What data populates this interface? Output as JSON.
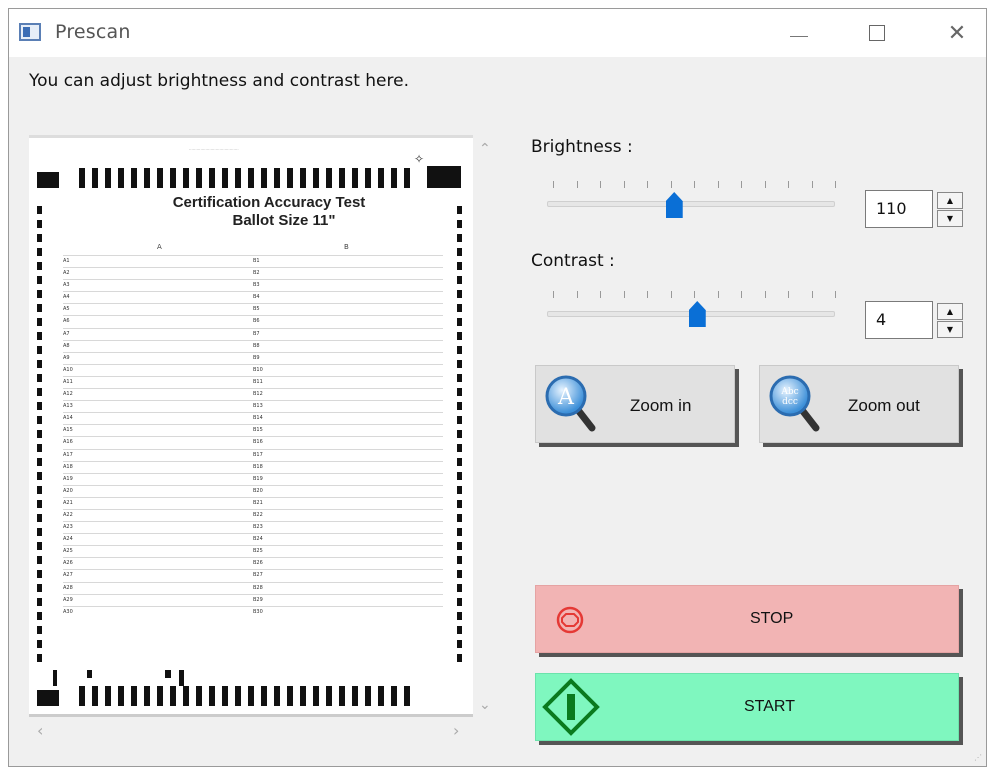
{
  "window": {
    "title": "Prescan"
  },
  "instruction": "You can adjust brightness and contrast here.",
  "preview": {
    "ballot_title": "Certification Accuracy Test",
    "ballot_subtitle": "Ballot  Size 11\"",
    "column_a": "A",
    "column_b": "B",
    "rows_a": [
      "A1",
      "A2",
      "A3",
      "A4",
      "A5",
      "A6",
      "A7",
      "A8",
      "A9",
      "A10",
      "A11",
      "A12",
      "A13",
      "A14",
      "A15",
      "A16",
      "A17",
      "A18",
      "A19",
      "A20",
      "A21",
      "A22",
      "A23",
      "A24",
      "A25",
      "A26",
      "A27",
      "A28",
      "A29",
      "A30"
    ],
    "rows_b": [
      "B1",
      "B2",
      "B3",
      "B4",
      "B5",
      "B6",
      "B7",
      "B8",
      "B9",
      "B10",
      "B11",
      "B12",
      "B13",
      "B14",
      "B15",
      "B16",
      "B17",
      "B18",
      "B19",
      "B20",
      "B21",
      "B22",
      "B23",
      "B24",
      "B25",
      "B26",
      "B27",
      "B28",
      "B29",
      "B30"
    ]
  },
  "brightness": {
    "label": "Brightness :",
    "value": "110",
    "slider_fraction": 0.44
  },
  "contrast": {
    "label": "Contrast :",
    "value": "4",
    "slider_fraction": 0.52
  },
  "buttons": {
    "zoom_in": "Zoom in",
    "zoom_out": "Zoom out",
    "stop": "STOP",
    "start": "START"
  },
  "colors": {
    "stop_bg": "#f2b4b4",
    "start_bg": "#7ff7bf",
    "slider_thumb": "#0a6fd6"
  },
  "icons": [
    "app-icon",
    "minimize-icon",
    "maximize-icon",
    "close-icon",
    "zoom-in-icon",
    "zoom-out-icon",
    "stop-icon",
    "start-icon"
  ]
}
